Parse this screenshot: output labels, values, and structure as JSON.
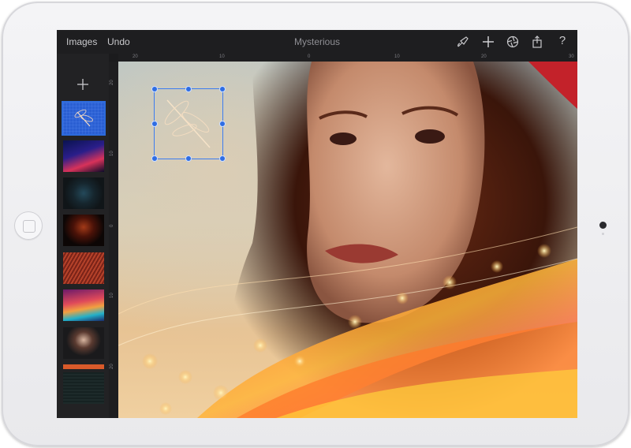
{
  "toolbar": {
    "images_label": "Images",
    "undo_label": "Undo",
    "title": "Mysterious",
    "icons": [
      "brush-icon",
      "plus-icon",
      "aperture-icon",
      "share-icon",
      "help-icon"
    ],
    "help_glyph": "?"
  },
  "ruler": {
    "top_ticks": [
      "20",
      "10",
      "0",
      "10",
      "20",
      "30"
    ],
    "left_ticks": [
      "20",
      "10",
      "0",
      "10",
      "20"
    ]
  },
  "sidebar": {
    "add_icon": "plus-icon",
    "layers": [
      {
        "name": "dragonfly",
        "selected": true
      },
      {
        "name": "blue-light-wave",
        "selected": false
      },
      {
        "name": "dark-particles",
        "selected": false
      },
      {
        "name": "woman-red-hair",
        "selected": false
      },
      {
        "name": "orange-mesh",
        "selected": false
      },
      {
        "name": "colorful-wave",
        "selected": false
      },
      {
        "name": "woman-portrait",
        "selected": false
      },
      {
        "name": "dark-texture",
        "selected": false
      }
    ]
  },
  "colors": {
    "accent": "#2d6bdc",
    "toolbar_bg": "#1e1e20",
    "sidebar_bg": "#222224"
  }
}
